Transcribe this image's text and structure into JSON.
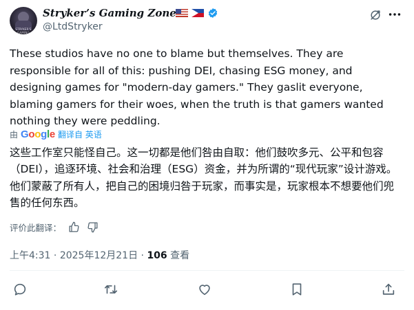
{
  "author": {
    "display_name": "Stryker’s Gaming Zone",
    "handle": "@LtdStryker",
    "avatar_text": "STRYKER'S GAMING",
    "flags": [
      "us-flag-icon",
      "ph-flag-icon"
    ],
    "verified": true
  },
  "tweet": {
    "text": "These studios have no one to blame but themselves. They are responsible for all of this: pushing DEI, chasing ESG money, and designing games for \"modern-day gamers.\" They gaslit everyone, blaming gamers for their woes, when the truth is that gamers wanted nothing they were peddling.",
    "translation_by": "由",
    "translation_provider": "Google",
    "translated_from": "翻译自",
    "source_language": "英语",
    "translated_text": "这些工作室只能怪自己。这一切都是他们咎由自取：他们鼓吹多元、公平和包容（DEI），追逐环境、社会和治理（ESG）资金，并为所谓的“现代玩家”设计游戏。他们蒙蔽了所有人，把自己的困境归咎于玩家，而事实是，玩家根本不想要他们兜售的任何东西。",
    "rate_translation_label": "评价此翻译：",
    "time": "上午4:31",
    "date": "2025年12月21日",
    "separator": "·",
    "views_count": "106",
    "views_label": "查看"
  },
  "colors": {
    "text": "#0f1419",
    "secondary": "#536471",
    "link": "#1d9bf0",
    "verified_badge": "#1d9bf0"
  },
  "actions": [
    "reply-icon",
    "retweet-icon",
    "like-icon",
    "bookmark-icon",
    "share-icon"
  ]
}
